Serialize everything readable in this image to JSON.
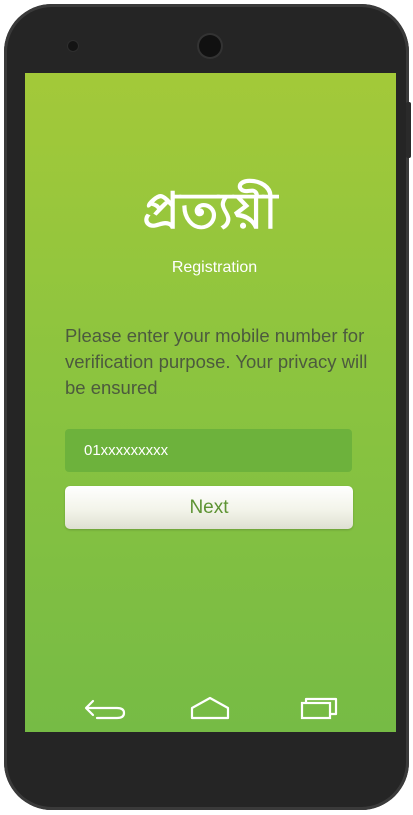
{
  "app": {
    "logo_text": "প্রত্যয়ী",
    "subtitle": "Registration"
  },
  "registration": {
    "message": "Please enter your mobile number for verification purpose. Your privacy will be ensured",
    "phone_value": "01xxxxxxxxx",
    "next_label": "Next"
  },
  "navigation": {
    "back_icon": "back-icon",
    "home_icon": "home-icon",
    "recent_icon": "recent-apps-icon"
  },
  "colors": {
    "screen_top": "#a3c939",
    "screen_bottom": "#76bb45",
    "input_background": "#6db23c",
    "button_text": "#5d9333",
    "phone_frame": "#252525"
  }
}
